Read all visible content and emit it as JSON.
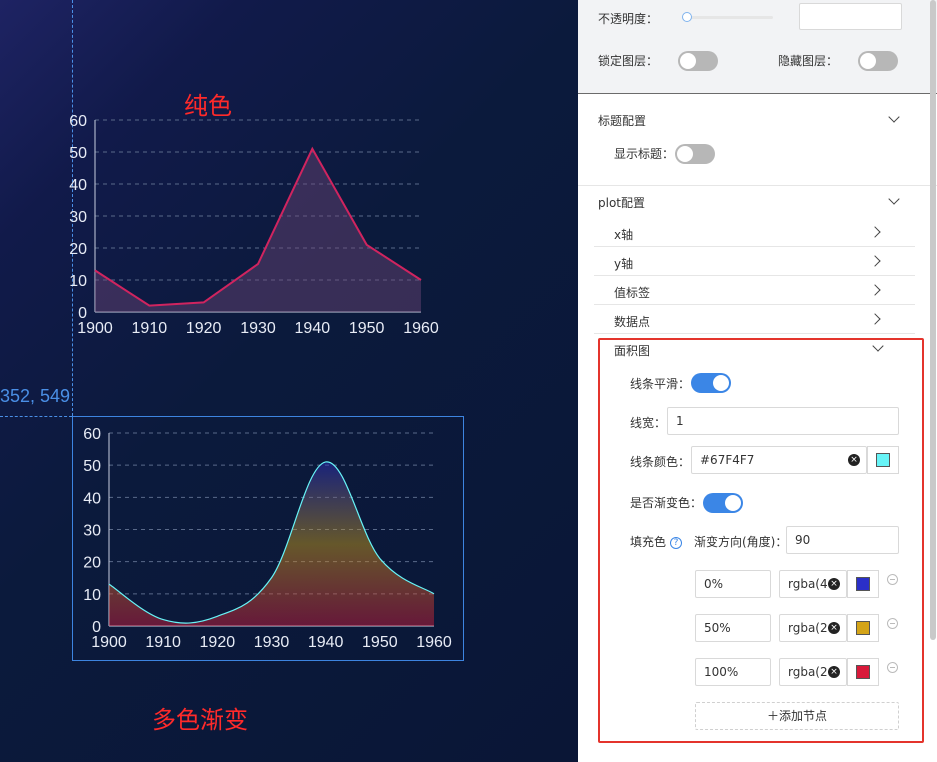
{
  "canvas": {
    "coord_readout": "352, 549",
    "caption_solid": "纯色",
    "caption_gradient": "多色渐变"
  },
  "chart_data": [
    {
      "type": "area",
      "x": [
        1900,
        1910,
        1920,
        1930,
        1940,
        1950,
        1960
      ],
      "values": [
        13,
        2,
        3,
        15,
        51,
        21,
        10
      ],
      "ylim": [
        0,
        60
      ],
      "yticks": [
        0,
        10,
        20,
        30,
        40,
        50,
        60
      ],
      "xticks": [
        1900,
        1910,
        1920,
        1930,
        1940,
        1950,
        1960
      ],
      "smooth": false,
      "line_color": "#d0245f",
      "fill": "solid",
      "grid": "dashed horizontal"
    },
    {
      "type": "area",
      "x": [
        1900,
        1910,
        1920,
        1930,
        1940,
        1950,
        1960
      ],
      "values": [
        13,
        2,
        3,
        15,
        51,
        21,
        10
      ],
      "ylim": [
        0,
        60
      ],
      "yticks": [
        0,
        10,
        20,
        30,
        40,
        50,
        60
      ],
      "xticks": [
        1900,
        1910,
        1920,
        1930,
        1940,
        1950,
        1960
      ],
      "smooth": true,
      "line_color": "#67F4F7",
      "fill": "gradient",
      "gradient_stops": [
        {
          "offset": "0%",
          "color": "#2b2fc8"
        },
        {
          "offset": "50%",
          "color": "#d4a418"
        },
        {
          "offset": "100%",
          "color": "#d8193a"
        }
      ],
      "grid": "dashed horizontal"
    }
  ],
  "panel": {
    "opacity_label": "不透明度：",
    "opacity_value": "",
    "lock_layer_label": "锁定图层：",
    "hide_layer_label": "隐藏图层：",
    "title_section": "标题配置",
    "show_title_label": "显示标题：",
    "plot_section": "plot配置",
    "sub_items": [
      "x轴",
      "y轴",
      "值标签",
      "数据点"
    ],
    "area_section": "面积图",
    "smooth_label": "线条平滑：",
    "line_width_label": "线宽：",
    "line_width_value": "1",
    "line_color_label": "线条颜色：",
    "line_color_value": "#67F4F7",
    "line_color_swatch": "#67F4F7",
    "gradient_label": "是否渐变色：",
    "fill_label": "填充色",
    "direction_label": "渐变方向(角度)：",
    "direction_value": "90",
    "stops": [
      {
        "offset": "0%",
        "color_text": "rgba(4",
        "swatch": "#2b2fc8"
      },
      {
        "offset": "50%",
        "color_text": "rgba(2",
        "swatch": "#d4a418"
      },
      {
        "offset": "100%",
        "color_text": "rgba(2",
        "swatch": "#d8193a"
      }
    ],
    "add_node_label": "＋添加节点"
  }
}
